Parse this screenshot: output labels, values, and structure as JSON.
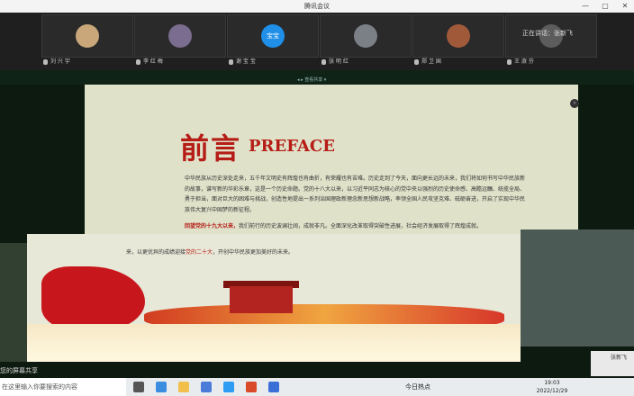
{
  "window": {
    "title": "腾讯会议",
    "minimize": "—",
    "maximize": "▢",
    "close": "✕"
  },
  "participants": [
    {
      "name": "刘 兴 宇",
      "avatar_color": "#c9a77a"
    },
    {
      "name": "李 红 梅",
      "avatar_color": "#7a6d8f"
    },
    {
      "name": "谢 宝 宝",
      "avatar_color": "#1f8fe8",
      "initials": "宝宝"
    },
    {
      "name": "张 明 红",
      "avatar_color": "#7b7f86"
    },
    {
      "name": "郑 卫 国",
      "avatar_color": "#a05a3a"
    },
    {
      "name": "王 淑 芬",
      "avatar_color": "#5c5c5c"
    }
  ],
  "speaker": {
    "label": "正在讲话：张新飞"
  },
  "share": {
    "viewing": "◂ ▸ 查看共享 ▾"
  },
  "slide": {
    "title_cn": "前言",
    "title_en": "PREFACE",
    "paragraph": "中华民族从历史深处走来，五千年文明史有辉煌也有曲折，有荣耀也有苦难。历史走到了今天，面向更长远的未来，我们将如何书写中华民族新的故事，谱写新的华彩乐章，这是一个历史命题。党的十八大以来，以习近平同志为核心的党中央以强烈的历史使命感、高瞻远瞩、统揽全局、勇于担当，面对巨大的困难与挑战，创造性地提出一系列治国理政新理念新思想新战略，率领全国人民攻坚克难、砥砺奋进，开启了实现中华民族伟大复兴中国梦的新征程。",
    "paragraph2_bold": "回望党的十九大以来，",
    "paragraph2": "我们前行的历史波澜壮阔，成就非凡。全面深化改革取得突破性进展，社会经济发展取得了辉煌成就。"
  },
  "slide2": {
    "text_before": "来，以更优异的成绩迎接",
    "text_red": "党的二十大",
    "text_after": "，开创中华民族更加美好的未来。"
  },
  "bottom": {
    "screen_share": "您的屏幕共享",
    "mini_cam_name": "张新飞"
  },
  "taskbar": {
    "search_placeholder": "在这里输入你要搜索的内容",
    "weather": "今日热点",
    "time": "19:03",
    "date": "2022/12/29"
  }
}
